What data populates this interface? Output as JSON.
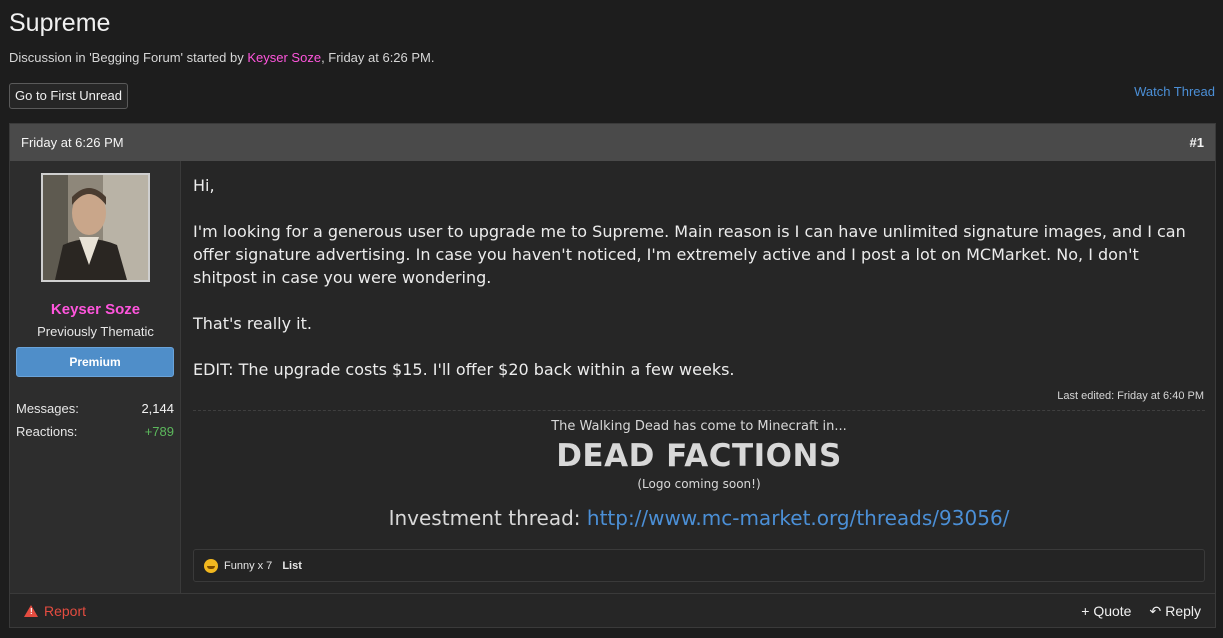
{
  "thread": {
    "title": "Supreme",
    "meta_prefix": "Discussion in 'Begging Forum' started by ",
    "author": "Keyser Soze",
    "meta_suffix": ", Friday at 6:26 PM."
  },
  "actions": {
    "first_unread": "Go to First Unread",
    "watch_thread": "Watch Thread"
  },
  "post": {
    "date": "Friday at 6:26 PM",
    "number": "#1",
    "user": {
      "name": "Keyser Soze",
      "title": "Previously Thematic",
      "badge": "Premium",
      "messages_label": "Messages:",
      "messages_value": "2,144",
      "reactions_label": "Reactions:",
      "reactions_value": "+789"
    },
    "body": [
      "Hi,",
      "I'm looking for a generous user to upgrade me to Supreme. Main reason is I can have unlimited signature images, and I can offer signature advertising. In case you haven't noticed, I'm extremely active and I post a lot on MCMarket. No, I don't shitpost in case you were wondering.",
      "That's really it.",
      "EDIT: The upgrade costs $15. I'll offer $20 back within a few weeks."
    ],
    "last_edited": "Last edited: Friday at 6:40 PM",
    "signature": {
      "line1": "The Walking Dead has come to Minecraft in...",
      "line2": "DEAD FACTIONS",
      "line3": "(Logo coming soon!)",
      "line4_label": "Investment thread: ",
      "line4_link": "http://www.mc-market.org/threads/93056/"
    },
    "reactions": {
      "summary": "Funny x 7",
      "list": "List"
    },
    "footer": {
      "report": "Report",
      "quote": "+ Quote",
      "reply": "Reply"
    }
  },
  "colors": {
    "username": "#ff55dd",
    "link": "#4b8fd6",
    "premium": "#4f8ec9",
    "positive": "#5cb85c",
    "report": "#e44c40"
  }
}
